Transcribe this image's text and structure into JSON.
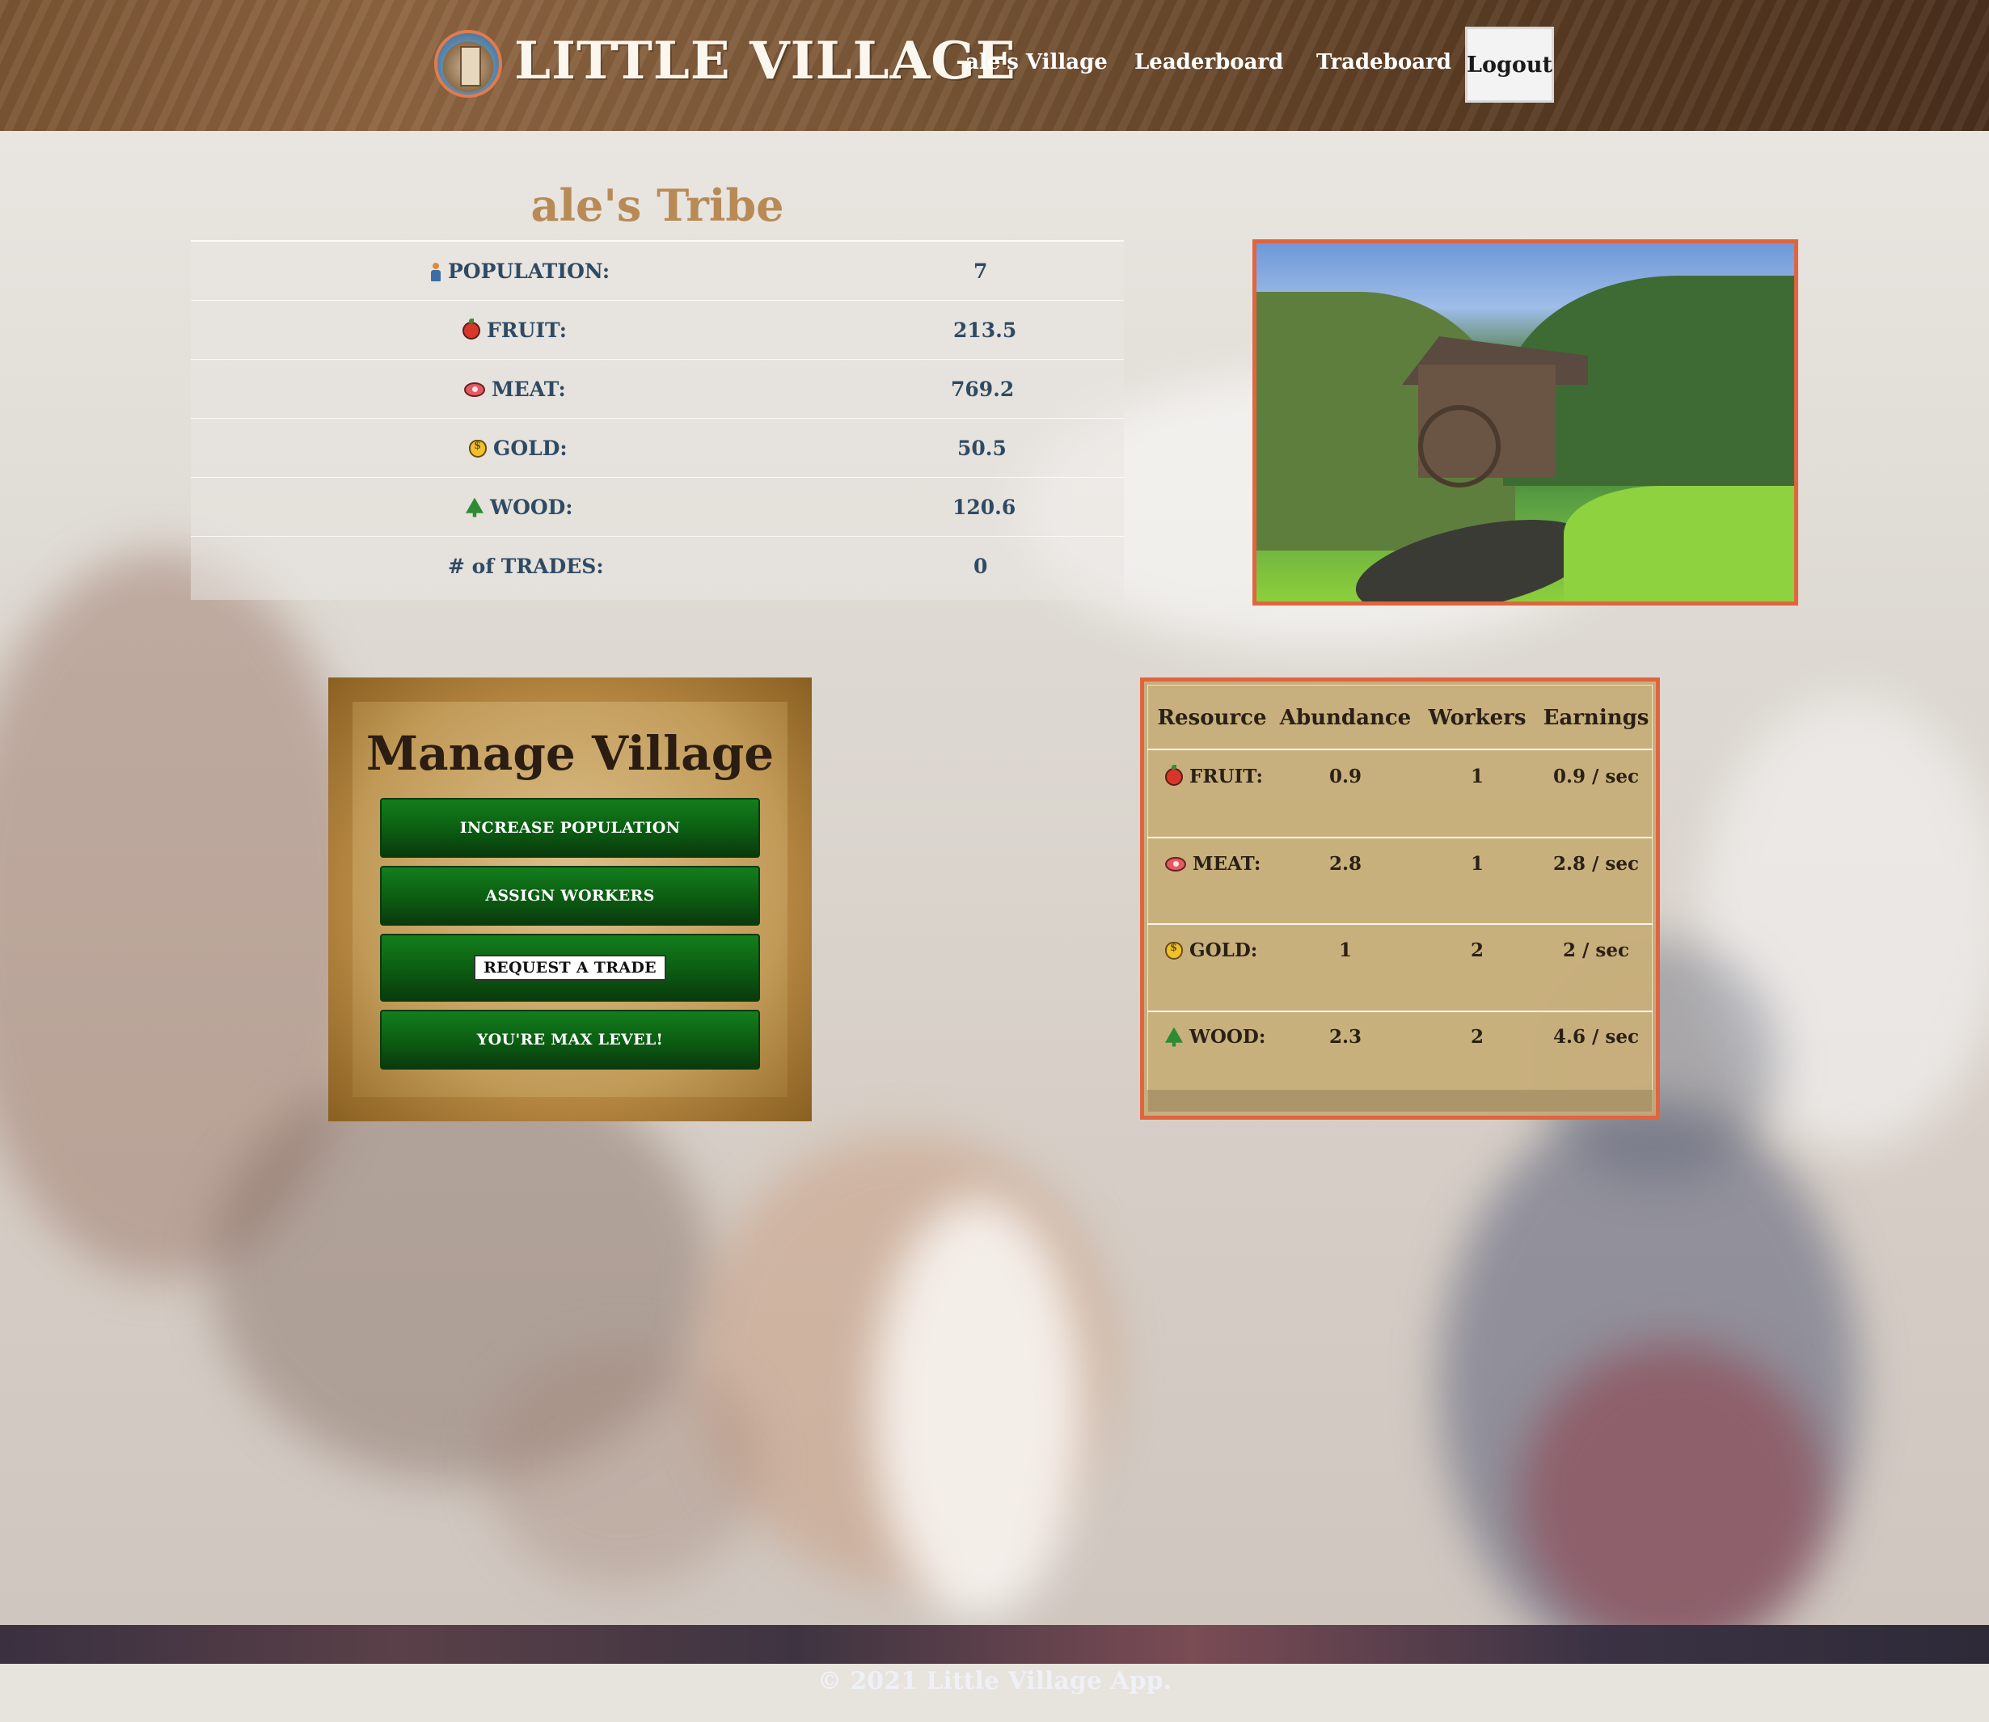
{
  "header": {
    "brand": "LITTLE VILLAGE",
    "nav": {
      "village": "ale's Village",
      "leaderboard": "Leaderboard",
      "tradeboard": "Tradeboard",
      "logout": "Logout"
    }
  },
  "tribe": {
    "title": "ale's Tribe",
    "stats": [
      {
        "icon": "person-icon",
        "label": "POPULATION:",
        "value": "7"
      },
      {
        "icon": "apple-icon",
        "label": "FRUIT:",
        "value": "213.5"
      },
      {
        "icon": "meat-icon",
        "label": "MEAT:",
        "value": "769.2"
      },
      {
        "icon": "money-bag-icon",
        "label": "GOLD:",
        "value": "50.5"
      },
      {
        "icon": "tree-icon",
        "label": "WOOD:",
        "value": "120.6"
      },
      {
        "icon": "",
        "label": "# of TRADES:",
        "value": "0"
      }
    ]
  },
  "manage": {
    "title": "Manage Village",
    "buttons": {
      "increase": "INCREASE POPULATION",
      "assign": "ASSIGN WORKERS",
      "trade": "REQUEST A TRADE",
      "max": "YOU'RE MAX LEVEL!"
    }
  },
  "resources": {
    "headers": [
      "Resource",
      "Abundance",
      "Workers",
      "Earnings"
    ],
    "rows": [
      {
        "icon": "apple-icon",
        "resource": "FRUIT:",
        "abundance": "0.9",
        "workers": "1",
        "earnings": "0.9 / sec"
      },
      {
        "icon": "meat-icon",
        "resource": "MEAT:",
        "abundance": "2.8",
        "workers": "1",
        "earnings": "2.8 / sec"
      },
      {
        "icon": "money-bag-icon",
        "resource": "GOLD:",
        "abundance": "1",
        "workers": "2",
        "earnings": "2 / sec"
      },
      {
        "icon": "tree-icon",
        "resource": "WOOD:",
        "abundance": "2.3",
        "workers": "2",
        "earnings": "4.6 / sec"
      }
    ]
  },
  "footer": {
    "copyright": "© 2021 Little Village App."
  },
  "colors": {
    "header_brown": "#7b5533",
    "stat_text": "#2f4a63",
    "tribe_title": "#b88a55",
    "button_green": "#0b5c12",
    "frame_orange": "#e0653f"
  }
}
